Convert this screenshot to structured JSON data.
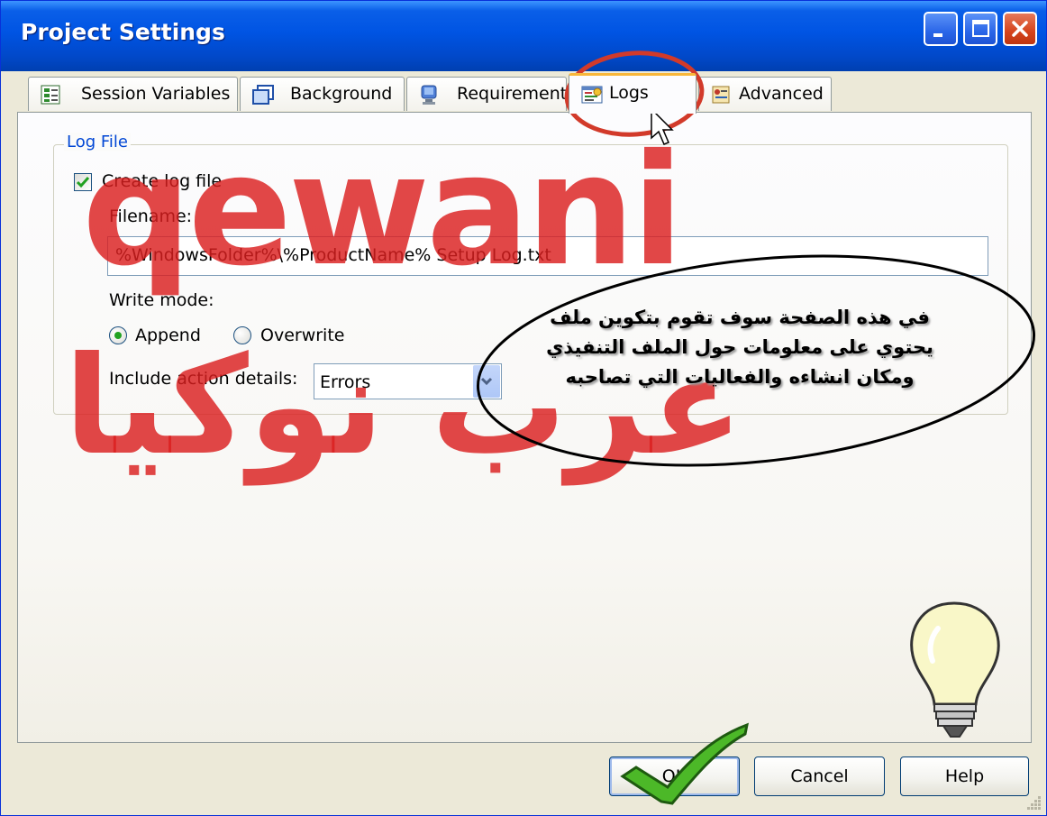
{
  "window": {
    "title": "Project Settings"
  },
  "tabs": [
    {
      "label": "Session Variables",
      "icon": "session-variables-icon"
    },
    {
      "label": "Background",
      "icon": "background-window-icon"
    },
    {
      "label": "Requirements",
      "icon": "monitor-icon"
    },
    {
      "label": "Logs",
      "icon": "logs-icon",
      "selected": true
    },
    {
      "label": "Advanced",
      "icon": "advanced-icon"
    }
  ],
  "log_file": {
    "group_label": "Log File",
    "create_log_label": "Create log file",
    "create_log_checked": true,
    "filename_label": "Filename:",
    "filename_value": "%WindowsFolder%\\%ProductName% Setup Log.txt",
    "write_mode_label": "Write mode:",
    "write_mode_options": [
      "Append",
      "Overwrite"
    ],
    "write_mode_selected": "Append",
    "action_details_label": "Include action details:",
    "action_details_value": "Errors"
  },
  "buttons": {
    "ok": "OK",
    "cancel": "Cancel",
    "help": "Help"
  },
  "watermark": {
    "latin": "qewani",
    "arabic": "عرب نوكيا"
  },
  "annotation": {
    "lines": [
      "في هذه الصفحة سوف تقوم بتكوين ملف",
      "يحتوي على معلومات حول الملف التنفيذي",
      "ومكان انشاءه والفعاليات التي تصاحبه"
    ]
  },
  "colors": {
    "titlebar": "#0054E3",
    "active_tab_accent": "#F8B73A",
    "group_label": "#0046D5",
    "watermark": "#DA1E1E"
  }
}
